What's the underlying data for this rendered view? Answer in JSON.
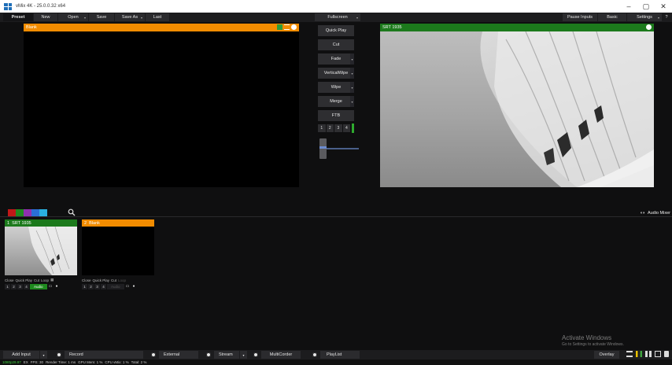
{
  "window": {
    "title": "vMix 4K - 25.0.0.32 x64",
    "minimize": "–",
    "restore": "▢",
    "close": "✕"
  },
  "menubar": {
    "preset": "Preset",
    "new": "New",
    "open": "Open",
    "save": "Save",
    "save_as": "Save As",
    "last": "Last",
    "fullscreen": "Fullscreen",
    "pause_inputs": "Pause Inputs",
    "basic": "Basic",
    "settings": "Settings",
    "help": "?"
  },
  "preview": {
    "title": "Blank"
  },
  "output": {
    "title": "SRT 1935"
  },
  "transitions": {
    "quick_play": "Quick Play",
    "cut": "Cut",
    "fade": "Fade",
    "vertical_wipe": "VerticalWipe",
    "wipe": "Wipe",
    "merge": "Merge",
    "ftb": "FTB",
    "numbers": [
      "1",
      "2",
      "3",
      "4"
    ],
    "tbar_position": 0
  },
  "colors": {
    "swatches": [
      "#c01818",
      "#1f8a1f",
      "#9030b0",
      "#2a6fd6",
      "#2ab0e0"
    ],
    "preview_accent": "#f28c00",
    "program_accent": "#1c7a1c"
  },
  "audio_mixer": {
    "label": "Audio Mixer"
  },
  "inputs": [
    {
      "number": "1",
      "name": "SRT 1935",
      "header_color": "#1c7a1c",
      "controls": [
        "Close",
        "Quick Play",
        "Cut",
        "Loop"
      ],
      "nums": [
        "1",
        "2",
        "3",
        "4"
      ],
      "audio": "Audio",
      "audio_on": true
    },
    {
      "number": "2",
      "name": "Blank",
      "header_color": "#f28c00",
      "controls": [
        "Close",
        "Quick Play",
        "Cut",
        "Loop"
      ],
      "nums": [
        "1",
        "2",
        "3",
        "4"
      ],
      "audio": "Audio",
      "audio_on": false
    }
  ],
  "watermark": {
    "line1": "Activate Windows",
    "line2": "Go to Settings to activate Windows."
  },
  "bottombar": {
    "add_input": "Add Input",
    "record": "Record",
    "external": "External",
    "stream": "Stream",
    "multicorder": "MultiCorder",
    "playlist": "PlayList",
    "overlay": "Overlay"
  },
  "status": {
    "resolution": "1080p29.97",
    "ex": "EX",
    "fps": "FPS: 30",
    "render_time": "Render Time: 1 ms",
    "gpu_mem": "GPU Mem: 1 %",
    "cpu_vmix": "CPU vMix: 1 %",
    "total": "Total: 2 %"
  }
}
